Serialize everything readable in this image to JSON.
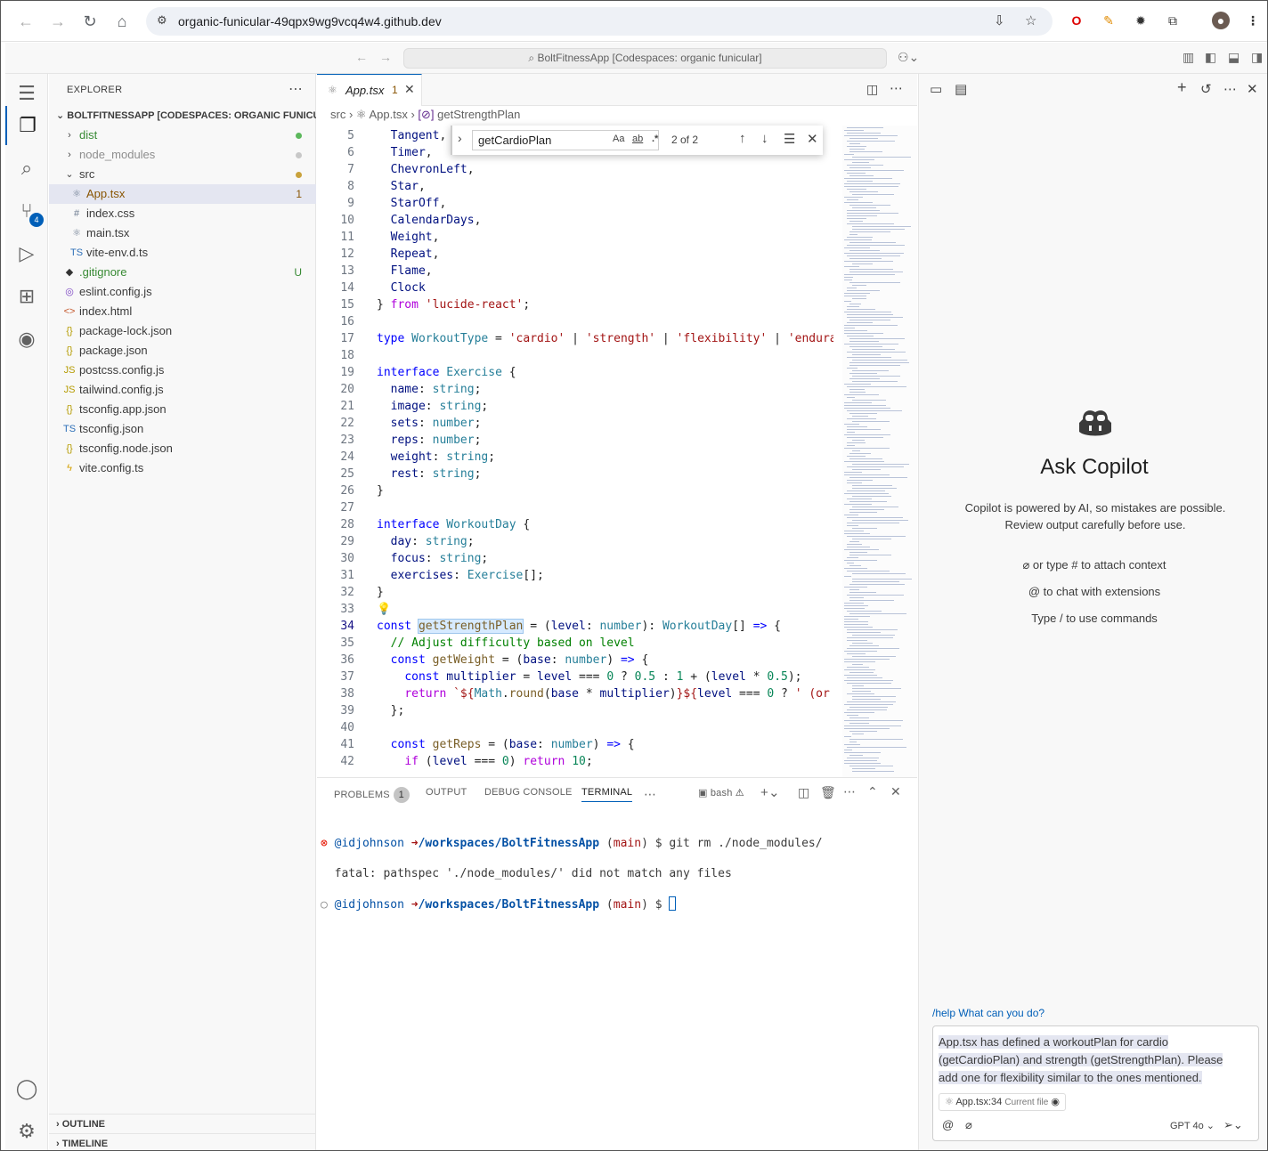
{
  "browser": {
    "url": "organic-funicular-49qpx9wg9vcq4w4.github.dev"
  },
  "titlebar": {
    "command_center": "BoltFitnessApp [Codespaces: organic funicular]"
  },
  "activity": {
    "scm_badge": "4"
  },
  "explorer": {
    "title": "EXPLORER",
    "root": "BOLTFITNESSAPP [CODESPACES: ORGANIC FUNICU...",
    "items": [
      {
        "name": "dist",
        "icon": "chevron-right",
        "depth": 1,
        "decoration": "dot-green"
      },
      {
        "name": "node_modules",
        "icon": "chevron-right",
        "depth": 1,
        "decoration": "dot-gray"
      },
      {
        "name": "src",
        "icon": "chevron-down",
        "depth": 1,
        "decoration": "dot-gold"
      },
      {
        "name": "App.tsx",
        "icon": "react-icon",
        "depth": 2,
        "decoration": "1",
        "selected": true
      },
      {
        "name": "index.css",
        "icon": "hash-icon",
        "depth": 2,
        "decoration": ""
      },
      {
        "name": "main.tsx",
        "icon": "react-icon",
        "depth": 2,
        "decoration": ""
      },
      {
        "name": "vite-env.d.ts",
        "icon": "ts-icon",
        "depth": 2,
        "decoration": ""
      },
      {
        "name": ".gitignore",
        "icon": "git-icon",
        "depth": 1,
        "decoration": "U"
      },
      {
        "name": "eslint.config.js",
        "icon": "eslint-icon",
        "depth": 1,
        "decoration": ""
      },
      {
        "name": "index.html",
        "icon": "html-icon",
        "depth": 1,
        "decoration": ""
      },
      {
        "name": "package-lock.json",
        "icon": "json-icon",
        "depth": 1,
        "decoration": ""
      },
      {
        "name": "package.json",
        "icon": "json-icon",
        "depth": 1,
        "decoration": ""
      },
      {
        "name": "postcss.config.js",
        "icon": "js-icon",
        "depth": 1,
        "decoration": ""
      },
      {
        "name": "tailwind.config.js",
        "icon": "js-icon",
        "depth": 1,
        "decoration": ""
      },
      {
        "name": "tsconfig.app.json",
        "icon": "json-icon",
        "depth": 1,
        "decoration": ""
      },
      {
        "name": "tsconfig.json",
        "icon": "ts-icon",
        "depth": 1,
        "decoration": ""
      },
      {
        "name": "tsconfig.node.json",
        "icon": "json-icon",
        "depth": 1,
        "decoration": ""
      },
      {
        "name": "vite.config.ts",
        "icon": "vite-icon",
        "depth": 1,
        "decoration": ""
      }
    ],
    "outline": "OUTLINE",
    "timeline": "TIMELINE"
  },
  "editor": {
    "tab_name": "App.tsx",
    "tab_problems": "1",
    "breadcrumb": [
      "src",
      "App.tsx",
      "getStrengthPlan"
    ],
    "find": {
      "query": "getCardioPlan",
      "count": "2 of 2",
      "opt_case": "Aa",
      "opt_word": "ab",
      "opt_regex": ".*"
    },
    "current_line": 34,
    "lines": [
      {
        "n": 5,
        "html": "  <span class=\"vr\">Tangent</span>,"
      },
      {
        "n": 6,
        "html": "  <span class=\"vr\">Timer</span>,"
      },
      {
        "n": 7,
        "html": "  <span class=\"vr\">ChevronLeft</span>,"
      },
      {
        "n": 8,
        "html": "  <span class=\"vr\">Star</span>,"
      },
      {
        "n": 9,
        "html": "  <span class=\"vr\">StarOff</span>,"
      },
      {
        "n": 10,
        "html": "  <span class=\"vr\">CalendarDays</span>,"
      },
      {
        "n": 11,
        "html": "  <span class=\"vr\">Weight</span>,"
      },
      {
        "n": 12,
        "html": "  <span class=\"vr\">Repeat</span>,"
      },
      {
        "n": 13,
        "html": "  <span class=\"vr\">Flame</span>,"
      },
      {
        "n": 14,
        "html": "  <span class=\"vr\">Clock</span>"
      },
      {
        "n": 15,
        "html": "} <span class=\"pu\">from</span> <span class=\"str\">'lucide-react'</span>;"
      },
      {
        "n": 16,
        "html": ""
      },
      {
        "n": 17,
        "html": "<span class=\"kw\">type</span> <span class=\"ty\">WorkoutType</span> = <span class=\"str\">'cardio'</span> | <span class=\"str\">'strength'</span> | <span class=\"str\">'flexibility'</span> | <span class=\"str\">'enduran</span>"
      },
      {
        "n": 18,
        "html": ""
      },
      {
        "n": 19,
        "html": "<span class=\"kw\">interface</span> <span class=\"ty\">Exercise</span> {"
      },
      {
        "n": 20,
        "html": "  <span class=\"vr\">name</span>: <span class=\"ty\">string</span>;"
      },
      {
        "n": 21,
        "html": "  <span class=\"vr\">image</span>: <span class=\"ty\">string</span>;"
      },
      {
        "n": 22,
        "html": "  <span class=\"vr\">sets</span>: <span class=\"ty\">number</span>;"
      },
      {
        "n": 23,
        "html": "  <span class=\"vr\">reps</span>: <span class=\"ty\">number</span>;"
      },
      {
        "n": 24,
        "html": "  <span class=\"vr\">weight</span>: <span class=\"ty\">string</span>;"
      },
      {
        "n": 25,
        "html": "  <span class=\"vr\">rest</span>: <span class=\"ty\">string</span>;"
      },
      {
        "n": 26,
        "html": "}"
      },
      {
        "n": 27,
        "html": ""
      },
      {
        "n": 28,
        "html": "<span class=\"kw\">interface</span> <span class=\"ty\">WorkoutDay</span> {"
      },
      {
        "n": 29,
        "html": "  <span class=\"vr\">day</span>: <span class=\"ty\">string</span>;"
      },
      {
        "n": 30,
        "html": "  <span class=\"vr\">focus</span>: <span class=\"ty\">string</span>;"
      },
      {
        "n": 31,
        "html": "  <span class=\"vr\">exercises</span>: <span class=\"ty\">Exercise</span>[];"
      },
      {
        "n": 32,
        "html": "}"
      },
      {
        "n": 33,
        "html": "<span style=\"color:#d4a000\">💡</span>"
      },
      {
        "n": 34,
        "html": "<span class=\"kw\">const</span> <span class=\"fn hl\">getStrengthPlan</span> = (<span class=\"vr\">level</span>: <span class=\"ty\">number</span>): <span class=\"ty\">WorkoutDay</span>[] <span class=\"kw\">=></span> {"
      },
      {
        "n": 35,
        "html": "  <span class=\"cm\">// Adjust difficulty based on level</span>"
      },
      {
        "n": 36,
        "html": "  <span class=\"kw\">const</span> <span class=\"fn\">getWeight</span> = (<span class=\"vr\">base</span>: <span class=\"ty\">number</span>) <span class=\"kw\">=></span> {"
      },
      {
        "n": 37,
        "html": "    <span class=\"kw\">const</span> <span class=\"vr\">multiplier</span> = <span class=\"vr\">level</span> === <span class=\"nm2\">0</span> ? <span class=\"nm2\">0.5</span> : <span class=\"nm2\">1</span> + (<span class=\"vr\">level</span> * <span class=\"nm2\">0.5</span>);"
      },
      {
        "n": 38,
        "html": "    <span class=\"pu\">return</span> <span class=\"str\">`${</span><span class=\"ty\">Math</span>.<span class=\"fn\">round</span>(<span class=\"vr\">base</span> * <span class=\"vr\">multiplier</span>)<span class=\"str\">}${</span><span class=\"vr\">level</span> === <span class=\"nm2\">0</span> ? <span class=\"str\">' (or b</span>"
      },
      {
        "n": 39,
        "html": "  };"
      },
      {
        "n": 40,
        "html": ""
      },
      {
        "n": 41,
        "html": "  <span class=\"kw\">const</span> <span class=\"fn\">getReps</span> = (<span class=\"vr\">base</span>: <span class=\"ty\">number</span>) <span class=\"kw\">=></span> {"
      },
      {
        "n": 42,
        "html": "    <span class=\"pu\">if</span> (<span class=\"vr\">level</span> === <span class=\"nm2\">0</span>) <span class=\"pu\">return</span> <span class=\"nm2\">10</span>;"
      }
    ]
  },
  "panel": {
    "tabs": [
      "PROBLEMS",
      "OUTPUT",
      "DEBUG CONSOLE",
      "TERMINAL"
    ],
    "problems_count": "1",
    "shell": "bash",
    "terminal": {
      "line1_user": "@idjohnson",
      "line1_path": "/workspaces/BoltFitnessApp",
      "line1_branch": "main",
      "line1_cmd": "$ git rm ./node_modules/",
      "line2": "fatal: pathspec './node_modules/' did not match any files",
      "line3_user": "@idjohnson",
      "line3_path": "/workspaces/BoltFitnessApp",
      "line3_branch": "main",
      "line3_prompt": "$"
    }
  },
  "copilot": {
    "title": "Ask Copilot",
    "disclaimer": "Copilot is powered by AI, so mistakes are possible. Review output carefully before use.",
    "hint1": "or type # to attach context",
    "hint2": "to chat with extensions",
    "hint3": "Type / to use commands",
    "help": "/help What can you do?",
    "input": "App.tsx has defined a workoutPlan for cardio (getCardioPlan) and strength (getStrengthPlan).  Please add one for flexibility similar to the ones mentioned.",
    "attachment": "App.tsx:34",
    "attachment_note": "Current file",
    "model": "GPT 4o"
  }
}
